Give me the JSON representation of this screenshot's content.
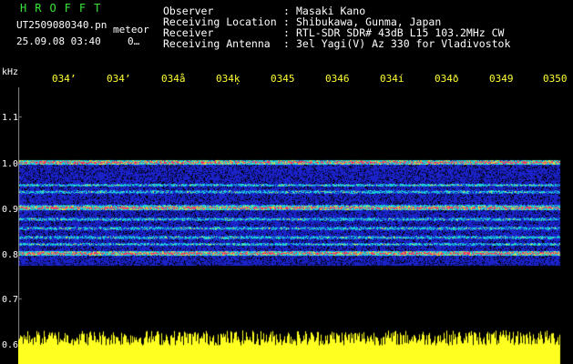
{
  "header": {
    "logo": "HROFFT",
    "filename": "UT2509080340.pn",
    "meteor_tag": "meteor",
    "timestamp": "25.09.08 03:40",
    "counter": "0…",
    "fields": [
      {
        "label": "Observer",
        "value": "Masaki Kano"
      },
      {
        "label": "Receiving Location",
        "value": "Shibukawa, Gunma, Japan"
      },
      {
        "label": "Receiver",
        "value": "RTL-SDR SDR# 43dB L15 103.2MHz CW"
      },
      {
        "label": "Receiving Antenna",
        "value": "3el Yagi(V) Az 330 for Vladivostok"
      }
    ]
  },
  "chart_data": {
    "type": "heatmap",
    "ylabel": "kHz",
    "x_tick_labels": [
      "034’",
      "034’",
      "034å",
      "034ķ",
      "0345",
      "0346",
      "034í",
      "034ð",
      "0349",
      "0350"
    ],
    "y_tick_labels": [
      "1.1",
      "1.0",
      "0.9",
      "0.8",
      "0.7",
      "0.6"
    ],
    "y_ticks": [
      1.1,
      1.0,
      0.9,
      0.8,
      0.7,
      0.6
    ],
    "ylim": [
      0.595,
      1.2
    ],
    "signal_band_khz": [
      0.78,
      1.0
    ],
    "strong_lines_khz": [
      0.9,
      0.8,
      1.0
    ],
    "medium_lines_khz": [
      0.95,
      0.935,
      0.875,
      0.855,
      0.835,
      0.82
    ],
    "noise_band_khz": [
      0.58,
      0.63
    ],
    "colors": {
      "background": "#000000",
      "weak": "#1a22c8",
      "medium": "#18d0d8",
      "strong": "#ff3060",
      "noise": "#ffff20",
      "grid": "#888888"
    }
  }
}
